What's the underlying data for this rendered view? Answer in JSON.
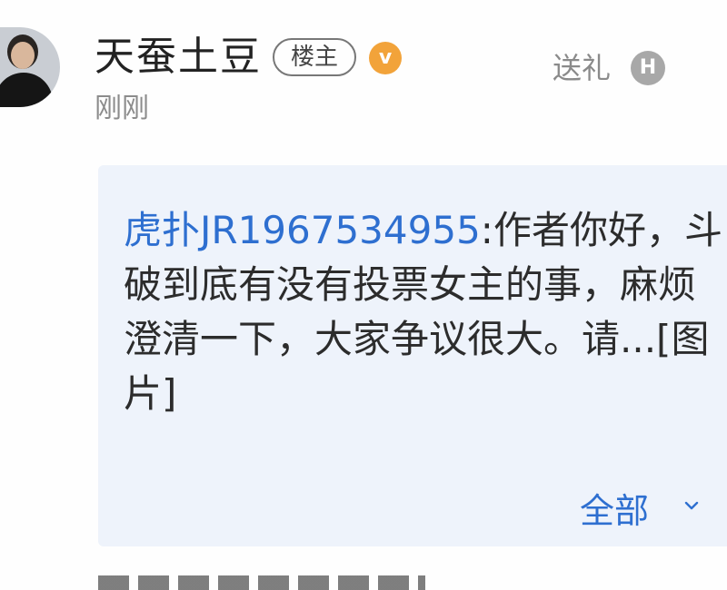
{
  "post": {
    "username": "天蚕土豆",
    "op_badge": "楼主",
    "verified_icon": "v-verified-icon",
    "timestamp": "刚刚",
    "gift_label": "送礼",
    "gift_icon": "h-coin-icon"
  },
  "quote": {
    "mention": "虎扑JR1967534955",
    "separator": ":",
    "body": "作者你好，斗破到底有没有投票女主的事，麻烦澄清一下，大家争议很大。请...[图片]",
    "expand_label": "全部"
  },
  "colors": {
    "mention": "#2e6fd0",
    "quote_bg": "#eef3fb",
    "verified": "#f2a33a"
  }
}
